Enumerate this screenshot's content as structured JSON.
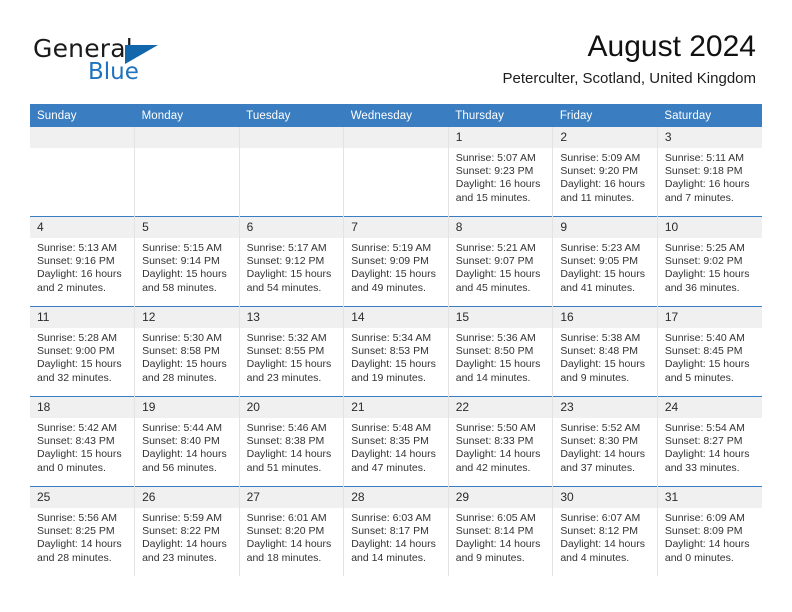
{
  "brand": {
    "name_top": "General",
    "name_bottom": "Blue",
    "accent_color": "#1266ab"
  },
  "header": {
    "month_title": "August 2024",
    "location": "Peterculter, Scotland, United Kingdom"
  },
  "theme": {
    "header_bar": "#3a7dc0",
    "daynum_band": "#f0f0f0",
    "text": "#333333"
  },
  "weekday_headers": [
    "Sunday",
    "Monday",
    "Tuesday",
    "Wednesday",
    "Thursday",
    "Friday",
    "Saturday"
  ],
  "weeks": [
    [
      {
        "day": "",
        "sunrise": "",
        "sunset": "",
        "daylight_1": "",
        "daylight_2": ""
      },
      {
        "day": "",
        "sunrise": "",
        "sunset": "",
        "daylight_1": "",
        "daylight_2": ""
      },
      {
        "day": "",
        "sunrise": "",
        "sunset": "",
        "daylight_1": "",
        "daylight_2": ""
      },
      {
        "day": "",
        "sunrise": "",
        "sunset": "",
        "daylight_1": "",
        "daylight_2": ""
      },
      {
        "day": "1",
        "sunrise": "Sunrise: 5:07 AM",
        "sunset": "Sunset: 9:23 PM",
        "daylight_1": "Daylight: 16 hours",
        "daylight_2": "and 15 minutes."
      },
      {
        "day": "2",
        "sunrise": "Sunrise: 5:09 AM",
        "sunset": "Sunset: 9:20 PM",
        "daylight_1": "Daylight: 16 hours",
        "daylight_2": "and 11 minutes."
      },
      {
        "day": "3",
        "sunrise": "Sunrise: 5:11 AM",
        "sunset": "Sunset: 9:18 PM",
        "daylight_1": "Daylight: 16 hours",
        "daylight_2": "and 7 minutes."
      }
    ],
    [
      {
        "day": "4",
        "sunrise": "Sunrise: 5:13 AM",
        "sunset": "Sunset: 9:16 PM",
        "daylight_1": "Daylight: 16 hours",
        "daylight_2": "and 2 minutes."
      },
      {
        "day": "5",
        "sunrise": "Sunrise: 5:15 AM",
        "sunset": "Sunset: 9:14 PM",
        "daylight_1": "Daylight: 15 hours",
        "daylight_2": "and 58 minutes."
      },
      {
        "day": "6",
        "sunrise": "Sunrise: 5:17 AM",
        "sunset": "Sunset: 9:12 PM",
        "daylight_1": "Daylight: 15 hours",
        "daylight_2": "and 54 minutes."
      },
      {
        "day": "7",
        "sunrise": "Sunrise: 5:19 AM",
        "sunset": "Sunset: 9:09 PM",
        "daylight_1": "Daylight: 15 hours",
        "daylight_2": "and 49 minutes."
      },
      {
        "day": "8",
        "sunrise": "Sunrise: 5:21 AM",
        "sunset": "Sunset: 9:07 PM",
        "daylight_1": "Daylight: 15 hours",
        "daylight_2": "and 45 minutes."
      },
      {
        "day": "9",
        "sunrise": "Sunrise: 5:23 AM",
        "sunset": "Sunset: 9:05 PM",
        "daylight_1": "Daylight: 15 hours",
        "daylight_2": "and 41 minutes."
      },
      {
        "day": "10",
        "sunrise": "Sunrise: 5:25 AM",
        "sunset": "Sunset: 9:02 PM",
        "daylight_1": "Daylight: 15 hours",
        "daylight_2": "and 36 minutes."
      }
    ],
    [
      {
        "day": "11",
        "sunrise": "Sunrise: 5:28 AM",
        "sunset": "Sunset: 9:00 PM",
        "daylight_1": "Daylight: 15 hours",
        "daylight_2": "and 32 minutes."
      },
      {
        "day": "12",
        "sunrise": "Sunrise: 5:30 AM",
        "sunset": "Sunset: 8:58 PM",
        "daylight_1": "Daylight: 15 hours",
        "daylight_2": "and 28 minutes."
      },
      {
        "day": "13",
        "sunrise": "Sunrise: 5:32 AM",
        "sunset": "Sunset: 8:55 PM",
        "daylight_1": "Daylight: 15 hours",
        "daylight_2": "and 23 minutes."
      },
      {
        "day": "14",
        "sunrise": "Sunrise: 5:34 AM",
        "sunset": "Sunset: 8:53 PM",
        "daylight_1": "Daylight: 15 hours",
        "daylight_2": "and 19 minutes."
      },
      {
        "day": "15",
        "sunrise": "Sunrise: 5:36 AM",
        "sunset": "Sunset: 8:50 PM",
        "daylight_1": "Daylight: 15 hours",
        "daylight_2": "and 14 minutes."
      },
      {
        "day": "16",
        "sunrise": "Sunrise: 5:38 AM",
        "sunset": "Sunset: 8:48 PM",
        "daylight_1": "Daylight: 15 hours",
        "daylight_2": "and 9 minutes."
      },
      {
        "day": "17",
        "sunrise": "Sunrise: 5:40 AM",
        "sunset": "Sunset: 8:45 PM",
        "daylight_1": "Daylight: 15 hours",
        "daylight_2": "and 5 minutes."
      }
    ],
    [
      {
        "day": "18",
        "sunrise": "Sunrise: 5:42 AM",
        "sunset": "Sunset: 8:43 PM",
        "daylight_1": "Daylight: 15 hours",
        "daylight_2": "and 0 minutes."
      },
      {
        "day": "19",
        "sunrise": "Sunrise: 5:44 AM",
        "sunset": "Sunset: 8:40 PM",
        "daylight_1": "Daylight: 14 hours",
        "daylight_2": "and 56 minutes."
      },
      {
        "day": "20",
        "sunrise": "Sunrise: 5:46 AM",
        "sunset": "Sunset: 8:38 PM",
        "daylight_1": "Daylight: 14 hours",
        "daylight_2": "and 51 minutes."
      },
      {
        "day": "21",
        "sunrise": "Sunrise: 5:48 AM",
        "sunset": "Sunset: 8:35 PM",
        "daylight_1": "Daylight: 14 hours",
        "daylight_2": "and 47 minutes."
      },
      {
        "day": "22",
        "sunrise": "Sunrise: 5:50 AM",
        "sunset": "Sunset: 8:33 PM",
        "daylight_1": "Daylight: 14 hours",
        "daylight_2": "and 42 minutes."
      },
      {
        "day": "23",
        "sunrise": "Sunrise: 5:52 AM",
        "sunset": "Sunset: 8:30 PM",
        "daylight_1": "Daylight: 14 hours",
        "daylight_2": "and 37 minutes."
      },
      {
        "day": "24",
        "sunrise": "Sunrise: 5:54 AM",
        "sunset": "Sunset: 8:27 PM",
        "daylight_1": "Daylight: 14 hours",
        "daylight_2": "and 33 minutes."
      }
    ],
    [
      {
        "day": "25",
        "sunrise": "Sunrise: 5:56 AM",
        "sunset": "Sunset: 8:25 PM",
        "daylight_1": "Daylight: 14 hours",
        "daylight_2": "and 28 minutes."
      },
      {
        "day": "26",
        "sunrise": "Sunrise: 5:59 AM",
        "sunset": "Sunset: 8:22 PM",
        "daylight_1": "Daylight: 14 hours",
        "daylight_2": "and 23 minutes."
      },
      {
        "day": "27",
        "sunrise": "Sunrise: 6:01 AM",
        "sunset": "Sunset: 8:20 PM",
        "daylight_1": "Daylight: 14 hours",
        "daylight_2": "and 18 minutes."
      },
      {
        "day": "28",
        "sunrise": "Sunrise: 6:03 AM",
        "sunset": "Sunset: 8:17 PM",
        "daylight_1": "Daylight: 14 hours",
        "daylight_2": "and 14 minutes."
      },
      {
        "day": "29",
        "sunrise": "Sunrise: 6:05 AM",
        "sunset": "Sunset: 8:14 PM",
        "daylight_1": "Daylight: 14 hours",
        "daylight_2": "and 9 minutes."
      },
      {
        "day": "30",
        "sunrise": "Sunrise: 6:07 AM",
        "sunset": "Sunset: 8:12 PM",
        "daylight_1": "Daylight: 14 hours",
        "daylight_2": "and 4 minutes."
      },
      {
        "day": "31",
        "sunrise": "Sunrise: 6:09 AM",
        "sunset": "Sunset: 8:09 PM",
        "daylight_1": "Daylight: 14 hours",
        "daylight_2": "and 0 minutes."
      }
    ]
  ]
}
